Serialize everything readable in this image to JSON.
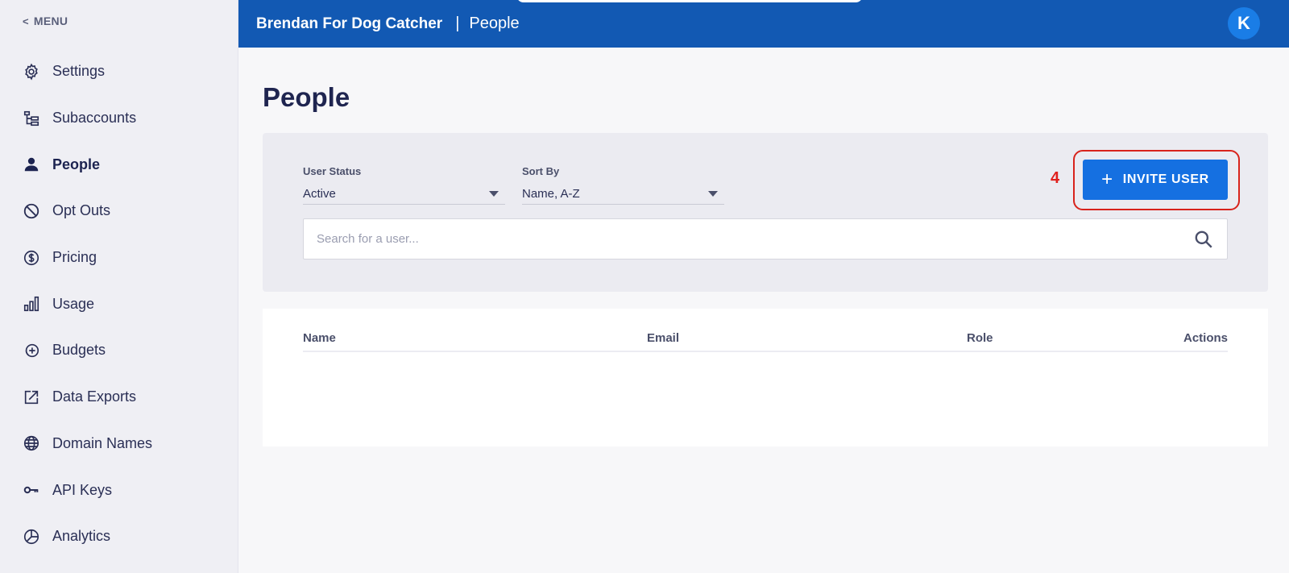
{
  "menu": {
    "label": "MENU"
  },
  "sidebar": {
    "items": [
      {
        "label": "Settings",
        "icon": "gear-icon"
      },
      {
        "label": "Subaccounts",
        "icon": "hierarchy-icon"
      },
      {
        "label": "People",
        "icon": "person-icon",
        "active": true
      },
      {
        "label": "Opt Outs",
        "icon": "block-icon"
      },
      {
        "label": "Pricing",
        "icon": "dollar-circle-icon"
      },
      {
        "label": "Usage",
        "icon": "bar-chart-icon"
      },
      {
        "label": "Budgets",
        "icon": "budget-icon"
      },
      {
        "label": "Data Exports",
        "icon": "export-icon"
      },
      {
        "label": "Domain Names",
        "icon": "globe-icon"
      },
      {
        "label": "API Keys",
        "icon": "key-icon"
      },
      {
        "label": "Analytics",
        "icon": "pie-chart-icon"
      }
    ]
  },
  "header": {
    "account_name": "Brendan For Dog Catcher",
    "separator": "|",
    "breadcrumb": "People",
    "avatar_initial": "K"
  },
  "page": {
    "title": "People"
  },
  "filters": {
    "user_status": {
      "label": "User Status",
      "value": "Active"
    },
    "sort_by": {
      "label": "Sort By",
      "value": "Name, A-Z"
    }
  },
  "annotation": {
    "step_number": "4"
  },
  "invite_button": {
    "label": "INVITE USER"
  },
  "search": {
    "placeholder": "Search for a user..."
  },
  "table": {
    "columns": [
      "Name",
      "Email",
      "Role",
      "Actions"
    ],
    "rows": []
  },
  "colors": {
    "header_bg": "#1259b3",
    "primary_button": "#1570e1",
    "annotation_red": "#d8231c",
    "sidebar_bg": "#efeff4"
  }
}
